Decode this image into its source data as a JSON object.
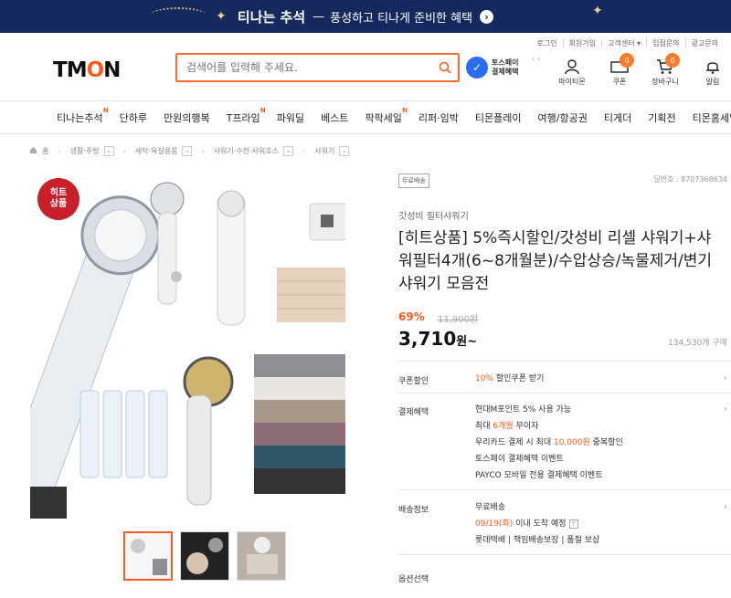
{
  "banner": {
    "title": "티나는 추석",
    "separator": "—",
    "subtitle": "풍성하고 티나게 준비한 혜택",
    "go": "›"
  },
  "topnav": [
    "로그인",
    "회원가입",
    "고객센터 ▾",
    "입점문의",
    "광고문의"
  ],
  "header": {
    "logo_left": "TM",
    "logo_o": "O",
    "logo_right": "N",
    "search_placeholder": "검색어를 입력해 주세요.",
    "tosspay_line1": "토스페이",
    "tosspay_line2": "결제혜택",
    "arrows": "‹ ›",
    "icons": [
      {
        "name": "mypage",
        "label": "마이티몬"
      },
      {
        "name": "coupon",
        "label": "쿠폰",
        "badge": "0"
      },
      {
        "name": "cart",
        "label": "장바구니",
        "badge": "0"
      },
      {
        "name": "alarm",
        "label": "알림"
      }
    ]
  },
  "categories": [
    {
      "label": "티나는추석",
      "new": "N"
    },
    {
      "label": "단하루"
    },
    {
      "label": "만원의행복"
    },
    {
      "label": "T프라임",
      "new": "N"
    },
    {
      "label": "파워딜"
    },
    {
      "label": "베스트"
    },
    {
      "label": "팍팍세일",
      "new": "N"
    },
    {
      "label": "리퍼·임박"
    },
    {
      "label": "티몬플레이"
    },
    {
      "label": "여행/항공권"
    },
    {
      "label": "티게더"
    },
    {
      "label": "기획전"
    },
    {
      "label": "티몬홈세일"
    }
  ],
  "breadcrumb": [
    "홈",
    "생활·주방",
    "세탁·욕실용품",
    "샤워기·수전·샤워호스",
    "샤워기"
  ],
  "product": {
    "hit_badge_line1": "히트",
    "hit_badge_line2": "상품",
    "free_shipping_tag": "무료배송",
    "product_no": "딜번호 : 8707368634",
    "brand": "갓성비 필터샤워기",
    "title": "[히트상품] 5%즉시할인/갓성비 리셀 샤워기+샤워필터4개(6~8개월분)/수압상승/녹물제거/변기샤워기 모음전",
    "discount": "69%",
    "original_price": "11,900원",
    "price": "3,710",
    "price_unit": "원~",
    "sold": "134,530개 구매"
  },
  "coupon": {
    "label": "쿠폰할인",
    "pct": "10%",
    "text": " 할인쿠폰 받기"
  },
  "payment": {
    "label": "결제혜택",
    "lines": [
      {
        "pre": "현대M포인트 5% 사용 가능",
        "hl": "",
        "post": ""
      },
      {
        "pre": "최대 ",
        "hl": "6개월",
        "post": " 무이자"
      },
      {
        "pre": "우리카드 결제 시 최대 ",
        "hl": "10,000원",
        "post": " 중복할인"
      },
      {
        "pre": "토스페이 결제혜택 이벤트",
        "hl": "",
        "post": ""
      },
      {
        "pre": "PAYCO 모바일 전용 결제혜택 이벤트",
        "hl": "",
        "post": ""
      }
    ]
  },
  "shipping": {
    "label": "배송정보",
    "type": "무료배송",
    "date": "09/19(화)",
    "date_suffix": " 이내 도착 예정",
    "q": "?",
    "carrier": "롯데택배 | 책임배송보장 | 품절 보상"
  },
  "options": {
    "label": "옵션선택"
  },
  "colors": {
    "accent": "#ff5a1f",
    "banner": "#14295e",
    "hit": "#c8202a"
  }
}
